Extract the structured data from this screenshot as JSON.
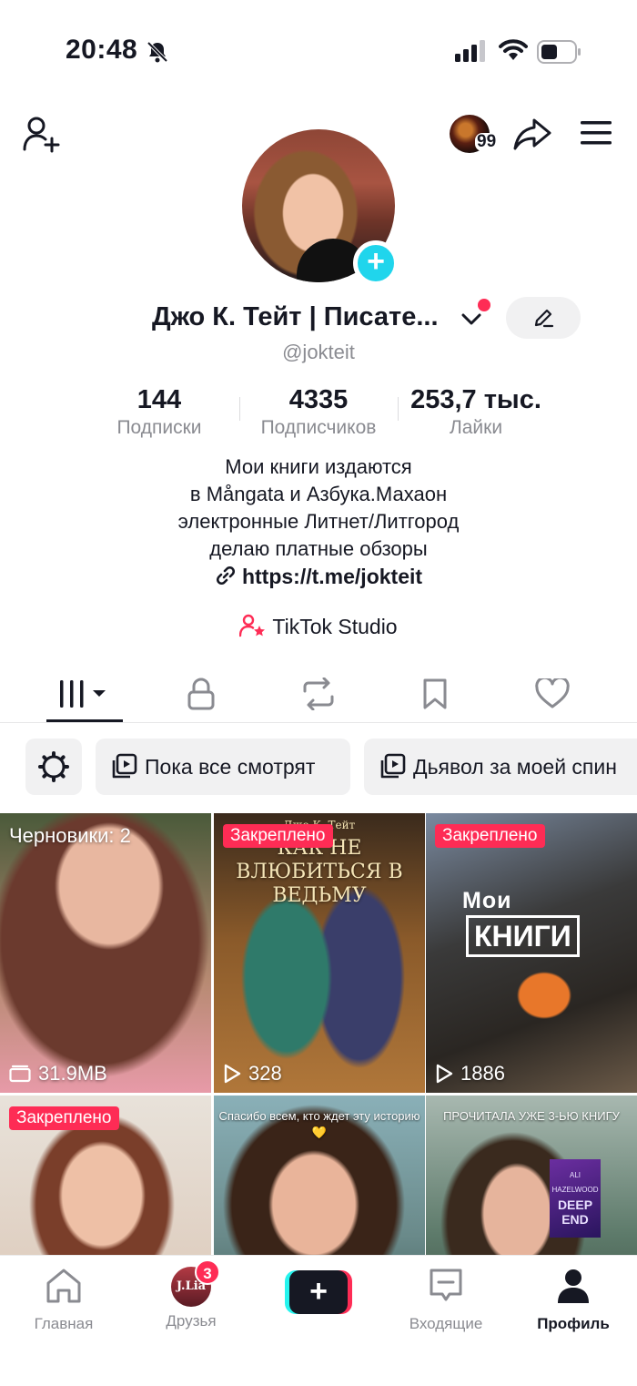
{
  "status_bar": {
    "time": "20:48",
    "icons": [
      "bell-slash-icon",
      "signal-icon",
      "wifi-icon",
      "battery-icon"
    ]
  },
  "top_bar": {
    "story_count": "99",
    "icons": [
      "add-friend-icon",
      "share-icon",
      "menu-icon"
    ]
  },
  "profile": {
    "display_name": "Джо К. Тейт | Писате...",
    "username": "@jokteit",
    "stats": [
      {
        "value": "144",
        "label": "Подписки"
      },
      {
        "value": "4335",
        "label": "Подписчиков"
      },
      {
        "value": "253,7 тыс.",
        "label": "Лайки"
      }
    ],
    "bio_lines": [
      "Мои книги издаются",
      "в Mångata и Азбука.Махаон",
      "электронные Литнет/Литгород",
      "делаю платные обзоры"
    ],
    "link": "https://t.me/jokteit",
    "studio_label": "TikTok Studio"
  },
  "tabs": [
    "videos-grid-icon",
    "lock-icon",
    "repost-icon",
    "bookmark-icon",
    "heart-icon"
  ],
  "playlists": [
    {
      "label": "Пока все смотрят"
    },
    {
      "label": "Дьявол за моей спин"
    }
  ],
  "videos": [
    {
      "draft_label": "Черновики: 2",
      "meta": "31.9MB",
      "colors": [
        "#6b3a2e",
        "#e79aa8"
      ]
    },
    {
      "badge": "Закреплено",
      "meta": "328",
      "cover_author": "Джо К. Тейт",
      "cover_title": "КАК НЕ ВЛЮБИТЬСЯ В ВЕДЬМУ",
      "colors": [
        "#3a2a1c",
        "#b0773a"
      ]
    },
    {
      "badge": "Закреплено",
      "meta": "1886",
      "moi": "Мои",
      "knigi": "КНИГИ",
      "colors": [
        "#2a2622",
        "#6b5a48"
      ]
    },
    {
      "badge": "Закреплено",
      "colors": [
        "#6a4e3e",
        "#d9c2b0"
      ]
    },
    {
      "caption": "Спасибо всем, кто ждет эту историю💛",
      "colors": [
        "#8ab0b8",
        "#2e4a42"
      ]
    },
    {
      "caption": "ПРОЧИТАЛА УЖЕ 3-ЬЮ КНИГУ",
      "book_title": "DEEP END",
      "book_author": "ALI HAZELWOOD",
      "colors": [
        "#5d7a6a",
        "#2c3b30"
      ]
    }
  ],
  "bottom_nav": [
    {
      "label": "Главная",
      "icon": "home-icon"
    },
    {
      "label": "Друзья",
      "avatar_text": "J.Lia",
      "badge": "3"
    },
    {
      "label": "",
      "icon": "plus-icon"
    },
    {
      "label": "Входящие",
      "icon": "inbox-icon"
    },
    {
      "label": "Профиль",
      "icon": "profile-icon"
    }
  ],
  "colors": {
    "accent": "#fe2c55",
    "cyan": "#25f4ee",
    "plus_badge": "#20d5ec",
    "text": "#161823",
    "muted": "#8a8b91"
  }
}
